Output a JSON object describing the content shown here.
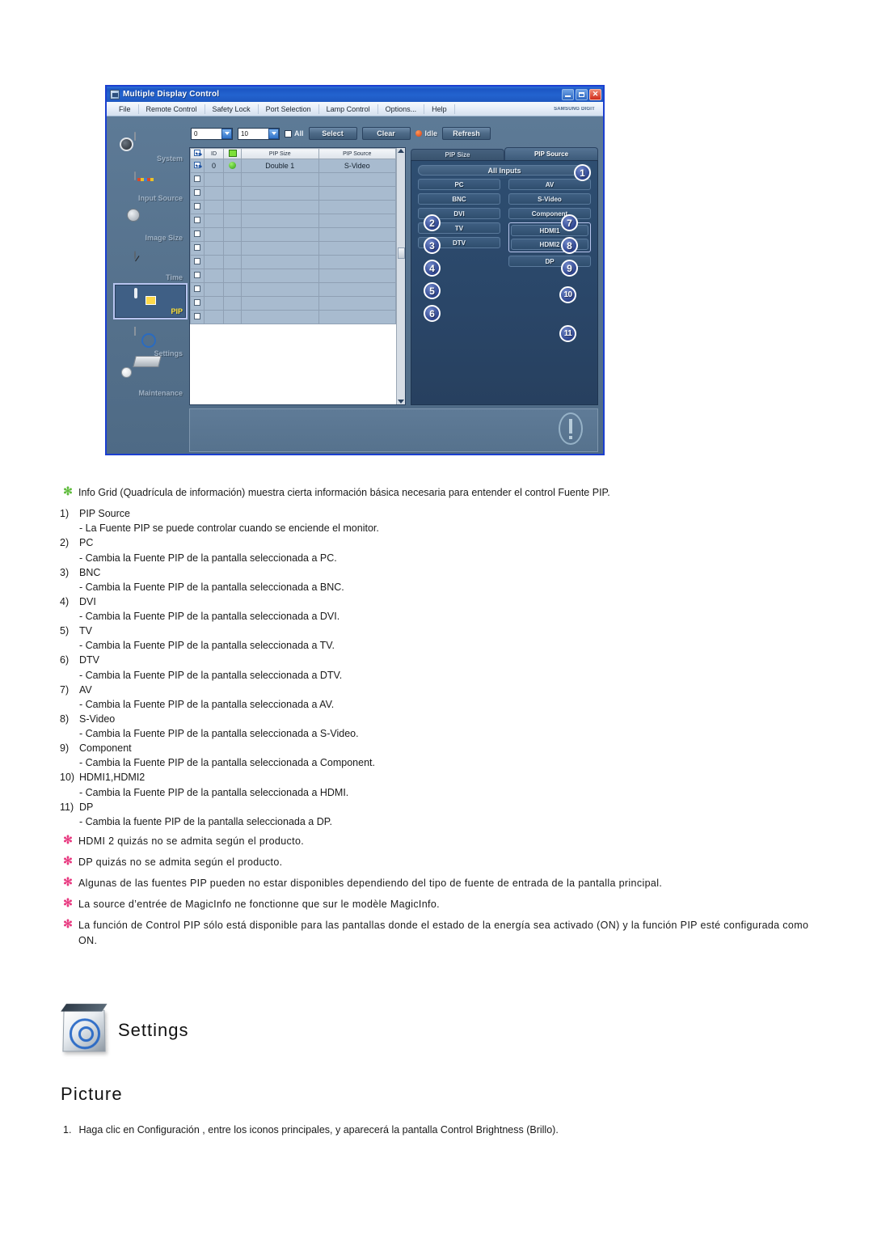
{
  "mdc": {
    "title": "Multiple Display Control",
    "brand": "SAMSUNG DIGIT",
    "window_buttons": {
      "minimize": "_",
      "maximize": "□",
      "close": "✕"
    },
    "menu": [
      "File",
      "Remote Control",
      "Safety Lock",
      "Port Selection",
      "Lamp Control",
      "Options...",
      "Help"
    ],
    "sidebar": [
      {
        "label": "System",
        "icon": "system-icon",
        "selected": false
      },
      {
        "label": "Input Source",
        "icon": "input-source-icon",
        "selected": false
      },
      {
        "label": "Image Size",
        "icon": "image-size-icon",
        "selected": false
      },
      {
        "label": "Time",
        "icon": "time-icon",
        "selected": false
      },
      {
        "label": "PIP",
        "icon": "pip-icon",
        "selected": true
      },
      {
        "label": "Settings",
        "icon": "settings-icon",
        "selected": false
      },
      {
        "label": "Maintenance",
        "icon": "maintenance-icon",
        "selected": false
      }
    ],
    "toolbar": {
      "range_start": "0",
      "range_end": "10",
      "all_label": "All",
      "select_label": "Select",
      "clear_label": "Clear",
      "status_label": "Idle",
      "refresh_label": "Refresh"
    },
    "grid": {
      "columns": [
        "",
        "ID",
        "",
        "PIP Size",
        "PIP Source"
      ],
      "rows": [
        {
          "checked": true,
          "id": "0",
          "power": "on",
          "pip_size": "Double 1",
          "pip_source": "S-Video"
        }
      ],
      "empty_row_count": 11
    },
    "tabs": [
      {
        "label": "PIP Size",
        "active": false
      },
      {
        "label": "PIP Source",
        "active": true
      }
    ],
    "source_panel": {
      "all_inputs_label": "All Inputs",
      "left_column": [
        "PC",
        "BNC",
        "DVI",
        "TV",
        "DTV"
      ],
      "right_column": [
        "AV",
        "S-Video",
        "Component"
      ],
      "hdmi_group": [
        "HDMI1",
        "HDMI2"
      ],
      "dp": "DP"
    },
    "callouts": [
      "1",
      "2",
      "3",
      "4",
      "5",
      "6",
      "7",
      "8",
      "9",
      "10",
      "11"
    ]
  },
  "doc": {
    "intro": "Info Grid (Quadrícula de información) muestra cierta información básica necesaria para entender el control Fuente PIP.",
    "items": [
      {
        "num": "1)",
        "label": "PIP Source",
        "desc": "- La Fuente PIP se puede controlar cuando se enciende el monitor."
      },
      {
        "num": "2)",
        "label": "PC",
        "desc": "- Cambia la Fuente PIP de la pantalla seleccionada a PC."
      },
      {
        "num": "3)",
        "label": "BNC",
        "desc": "- Cambia la Fuente PIP de la pantalla seleccionada a BNC."
      },
      {
        "num": "4)",
        "label": "DVI",
        "desc": "- Cambia la Fuente PIP de la pantalla seleccionada a DVI."
      },
      {
        "num": "5)",
        "label": "TV",
        "desc": "- Cambia la Fuente PIP de la pantalla seleccionada a TV."
      },
      {
        "num": "6)",
        "label": "DTV",
        "desc": "- Cambia la Fuente PIP de la pantalla seleccionada a DTV."
      },
      {
        "num": "7)",
        "label": "AV",
        "desc": "- Cambia la Fuente PIP de la pantalla seleccionada a AV."
      },
      {
        "num": "8)",
        "label": "S-Video",
        "desc": "- Cambia la Fuente PIP de la pantalla seleccionada a S-Video."
      },
      {
        "num": "9)",
        "label": "Component",
        "desc": "- Cambia la Fuente PIP de la pantalla seleccionada a Component."
      },
      {
        "num": "10)",
        "label": "HDMI1,HDMI2",
        "desc": "- Cambia la Fuente PIP de la pantalla seleccionada a HDMI."
      },
      {
        "num": "11)",
        "label": "DP",
        "desc": "- Cambia la fuente PIP de la pantalla seleccionada a DP."
      }
    ],
    "notes": [
      "HDMI 2 quizás no se admita según el producto.",
      "DP quizás no se admita según el producto.",
      "Algunas de las fuentes PIP pueden no estar disponibles dependiendo del tipo de fuente de entrada de la pantalla principal.",
      "La source d’entrée de MagicInfo ne fonctionne que sur le modèle MagicInfo.",
      "La función de Control PIP sólo está disponible para las pantallas donde el estado de la energía sea activado (ON) y la función PIP esté configurada como ON."
    ]
  },
  "settings_section": {
    "heading": "Settings",
    "subheading": "Picture",
    "step_num": "1.",
    "step_text": "Haga clic en Configuración , entre los iconos principales, y aparecerá la pantalla Control Brightness (Brillo)."
  }
}
